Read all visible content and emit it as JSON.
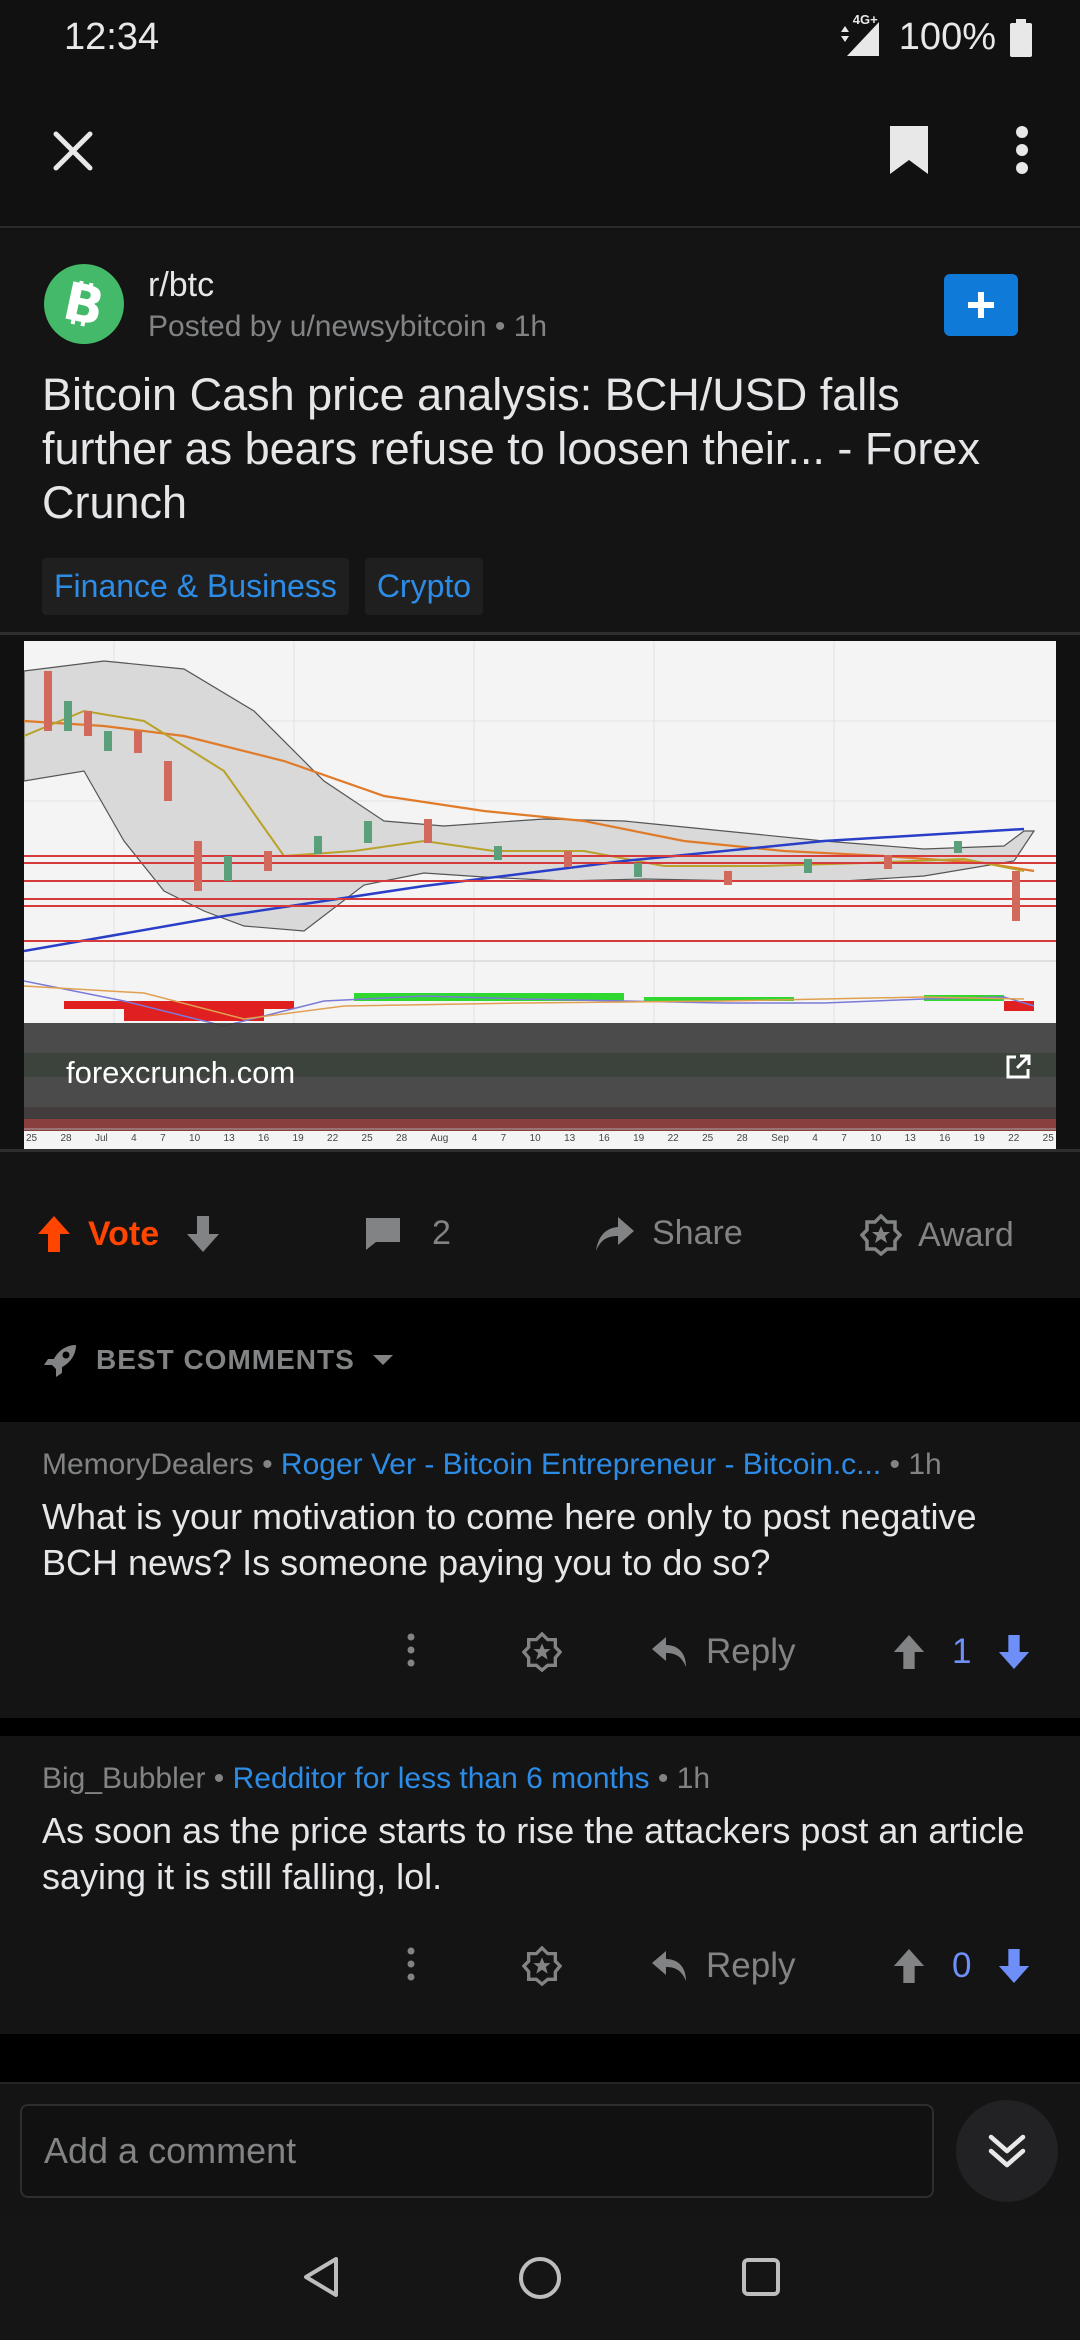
{
  "status_bar": {
    "time": "12:34",
    "network": "4G+",
    "battery": "100%"
  },
  "post": {
    "subreddit": "r/btc",
    "posted_by": "Posted by u/newsybitcoin",
    "age": "• 1h",
    "title": "Bitcoin Cash price analysis: BCH/USD falls further as bears refuse to loosen their... - Forex Crunch",
    "flairs": [
      "Finance & Business",
      "Crypto"
    ],
    "link_domain": "forexcrunch.com",
    "preview_axis_labels": [
      "25",
      "28",
      "Jul",
      "4",
      "7",
      "10",
      "13",
      "16",
      "19",
      "22",
      "25",
      "28",
      "Aug",
      "4",
      "7",
      "10",
      "13",
      "16",
      "19",
      "22",
      "25",
      "28",
      "Sep",
      "4",
      "7",
      "10",
      "13",
      "16",
      "19",
      "22",
      "25"
    ],
    "vote_label": "Vote",
    "comment_count": "2",
    "share_label": "Share",
    "award_label": "Award"
  },
  "comments_header": {
    "sort_label": "BEST COMMENTS"
  },
  "comments": [
    {
      "author": "MemoryDealers",
      "flair": "Roger Ver - Bitcoin Entrepreneur - Bitcoin.c...",
      "age": "1h",
      "body": "What is your motivation to come here only to post negative BCH news?  Is someone paying you to do so?",
      "reply_label": "Reply",
      "score": "1"
    },
    {
      "author": "Big_Bubbler",
      "flair": "Redditor for less than 6 months",
      "age": "1h",
      "body": "As soon as the price starts to rise the attackers post an article saying it is still falling, lol.",
      "reply_label": "Reply",
      "score": "0"
    }
  ],
  "add_comment": {
    "placeholder": "Add a comment"
  },
  "colors": {
    "upvote_active": "#ff4500",
    "link_blue": "#2c8ce6",
    "score_blue": "#6f8ff8",
    "join_blue": "#0f7ad8",
    "subreddit_green": "#45b96a"
  }
}
